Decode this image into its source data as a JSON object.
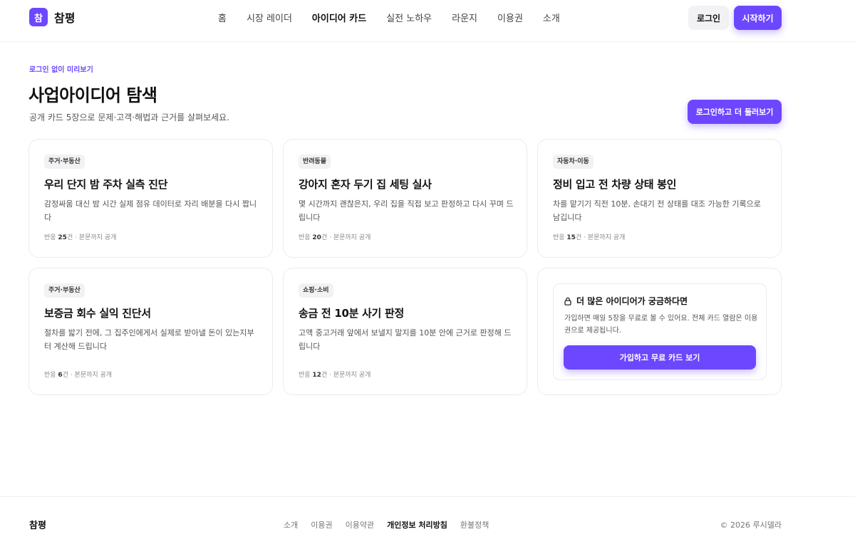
{
  "header": {
    "logo_mark": "참",
    "logo_text": "참평",
    "nav": [
      "홈",
      "시장 레이더",
      "아이디어 카드",
      "실전 노하우",
      "라운지",
      "이용권",
      "소개"
    ],
    "login": "로그인",
    "start": "시작하기"
  },
  "hero": {
    "eyebrow": "로그인 없이 미리보기",
    "title": "사업아이디어 탐색",
    "subtitle": "공개 카드 5장으로 문제·고객·해법과 근거를 살펴보세요.",
    "more_button": "로그인하고 더 둘러보기"
  },
  "cards": [
    {
      "tag": "주거·부동산",
      "title": "우리 단지 밤 주차 실측 진단",
      "desc": "감정싸움 대신 밤 시간 실제 점유 데이터로 자리 배분을 다시 짭니다",
      "meta_prefix": "반응 ",
      "count": "25",
      "meta_suffix": "건 · 본문까지 공개"
    },
    {
      "tag": "반려동물",
      "title": "강아지 혼자 두기 집 세팅 실사",
      "desc": "몇 시간까지 괜찮은지, 우리 집을 직접 보고 판정하고 다시 꾸며 드립니다",
      "meta_prefix": "반응 ",
      "count": "20",
      "meta_suffix": "건 · 본문까지 공개"
    },
    {
      "tag": "자동차·이동",
      "title": "정비 입고 전 차량 상태 봉인",
      "desc": "차를 맡기기 직전 10분, 손대기 전 상태를 대조 가능한 기록으로 남깁니다",
      "meta_prefix": "반응 ",
      "count": "15",
      "meta_suffix": "건 · 본문까지 공개"
    },
    {
      "tag": "주거·부동산",
      "title": "보증금 회수 실익 진단서",
      "desc": "절차를 밟기 전에, 그 집주인에게서 실제로 받아낼 돈이 있는지부터 계산해 드립니다",
      "meta_prefix": "반응 ",
      "count": "6",
      "meta_suffix": "건 · 본문까지 공개"
    },
    {
      "tag": "쇼핑·소비",
      "title": "송금 전 10분 사기 판정",
      "desc": "고액 중고거래 앞에서 보낼지 말지를 10분 안에 근거로 판정해 드립니다",
      "meta_prefix": "반응 ",
      "count": "12",
      "meta_suffix": "건 · 본문까지 공개"
    }
  ],
  "promo": {
    "title": "더 많은 아이디어가 궁금하다면",
    "desc": "가입하면 매일 5장을 무료로 볼 수 있어요. 전체 카드 열람은 이용권으로 제공됩니다.",
    "button": "가입하고 무료 카드 보기"
  },
  "footer": {
    "logo": "참평",
    "links": [
      "소개",
      "이용권",
      "이용약관",
      "개인정보 처리방침",
      "환불정책"
    ],
    "copyright": "© 2026 루시델라"
  },
  "colors": {
    "accent": "#6c47ff",
    "text": "#111111",
    "muted": "#555555",
    "border": "#ececf0"
  },
  "icons": {
    "promo": "lock-icon"
  }
}
